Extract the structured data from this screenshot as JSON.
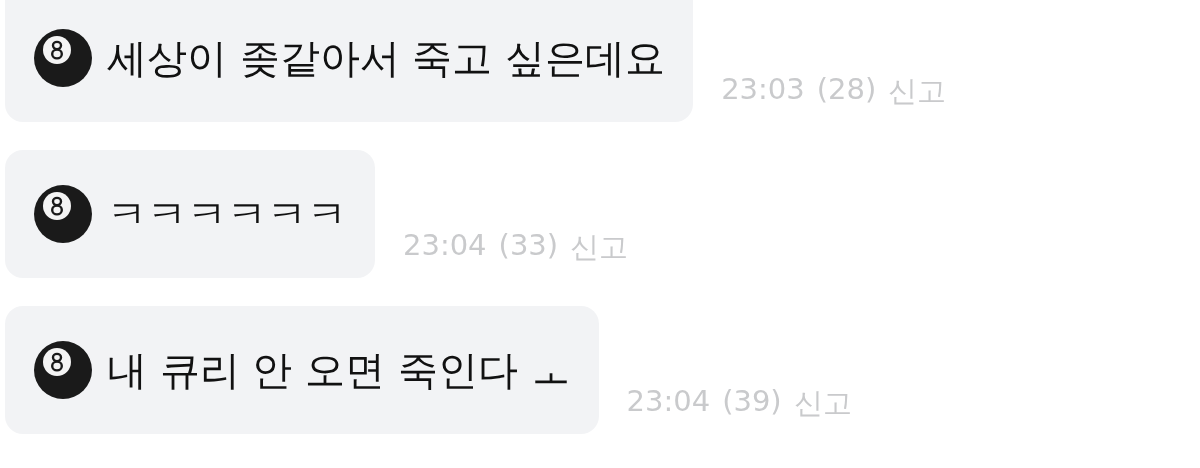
{
  "messages": [
    {
      "text": "세상이 좆같아서 죽고 싶은데요",
      "time": "23:03",
      "count": "(28)",
      "report": "신고"
    },
    {
      "text": "ㅋㅋㅋㅋㅋㅋ",
      "time": "23:04",
      "count": "(33)",
      "report": "신고"
    },
    {
      "text": "내 큐리 안 오면 죽인다 ㅗ",
      "time": "23:04",
      "count": "(39)",
      "report": "신고"
    }
  ]
}
